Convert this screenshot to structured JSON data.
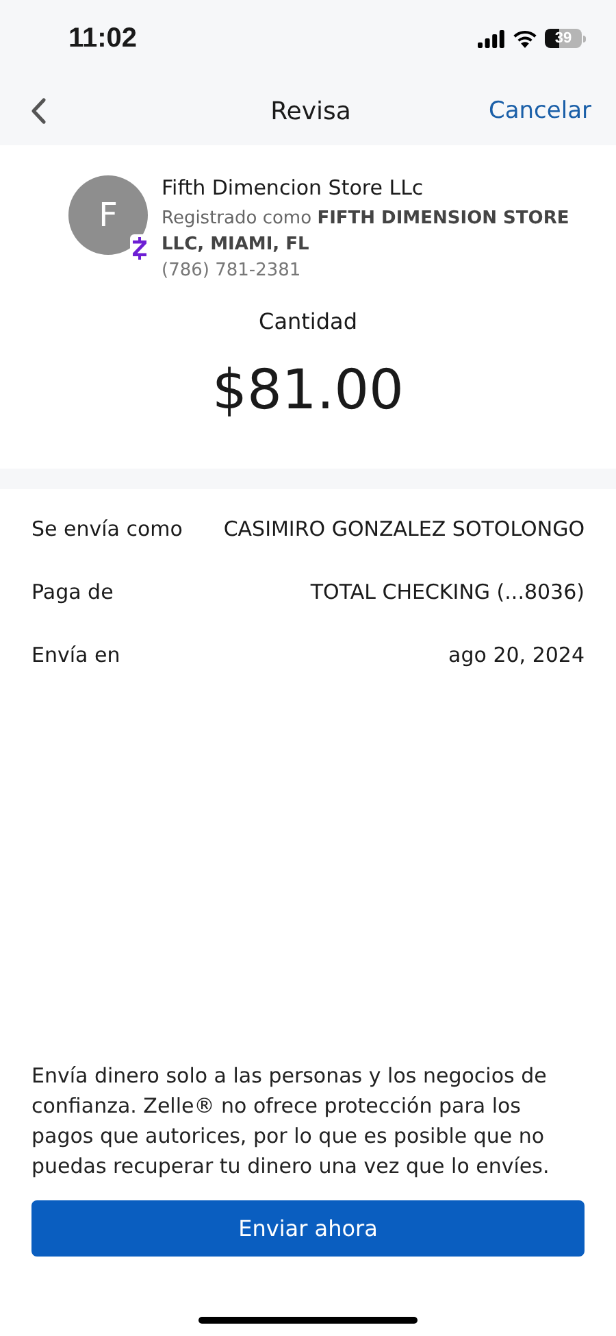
{
  "status_bar": {
    "time": "11:02",
    "battery": "39"
  },
  "nav": {
    "title": "Revisa",
    "cancel": "Cancelar"
  },
  "recipient": {
    "initial": "F",
    "name": "Fifth  Dimencion Store LLc",
    "registered": "Registrado como **FIFTH DIMENSION STORE LLC, MIAMI, FL**",
    "phone": "(786) 781-2381"
  },
  "amount": {
    "label": "Cantidad",
    "value": "$81.00"
  },
  "details": [
    {
      "label": "Se envía como",
      "value": "CASIMIRO GONZALEZ SOTOLONGO"
    },
    {
      "label": "Paga de",
      "value": "TOTAL CHECKING (...8036)"
    },
    {
      "label": "Envía en",
      "value": "ago 20, 2024"
    }
  ],
  "disclaimer": "Envía dinero solo a las personas y los negocios de confianza. Zelle® no ofrece protección para los pagos que autorices, por lo que es posible que no puedas recuperar tu dinero una vez que lo envíes.",
  "button": "Enviar ahora"
}
